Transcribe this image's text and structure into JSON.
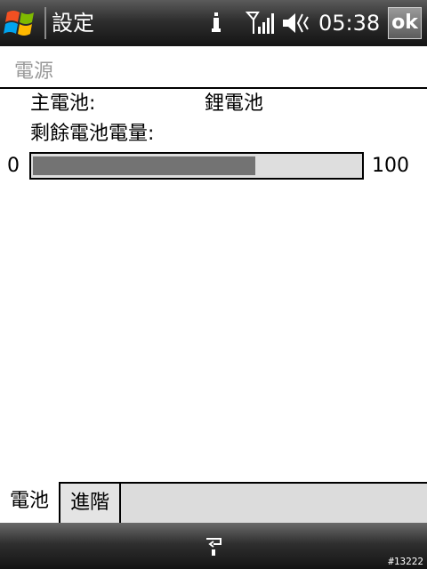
{
  "topbar": {
    "title": "設定",
    "clock": "05:38",
    "ok_label": "ok",
    "icons": [
      "windows-start-icon",
      "connectivity-icon",
      "signal-strength-icon",
      "volume-icon"
    ]
  },
  "page": {
    "header": "電源"
  },
  "battery": {
    "main_label": "主電池:",
    "main_value": "鋰電池",
    "remaining_label": "剩餘電池電量:",
    "range_min": "0",
    "range_max": "100",
    "level_fraction": 0.68
  },
  "tabs": [
    {
      "label": "電池",
      "active": true
    },
    {
      "label": "進階",
      "active": false
    }
  ],
  "bottombar": {
    "input_icon": "keyboard-sip-icon",
    "corner_id": "#13222"
  },
  "colors": {
    "bar_bg": "#1f1f1f",
    "progress_fill": "#737373",
    "progress_track": "#dedede",
    "header_text": "#9a9a9a"
  }
}
